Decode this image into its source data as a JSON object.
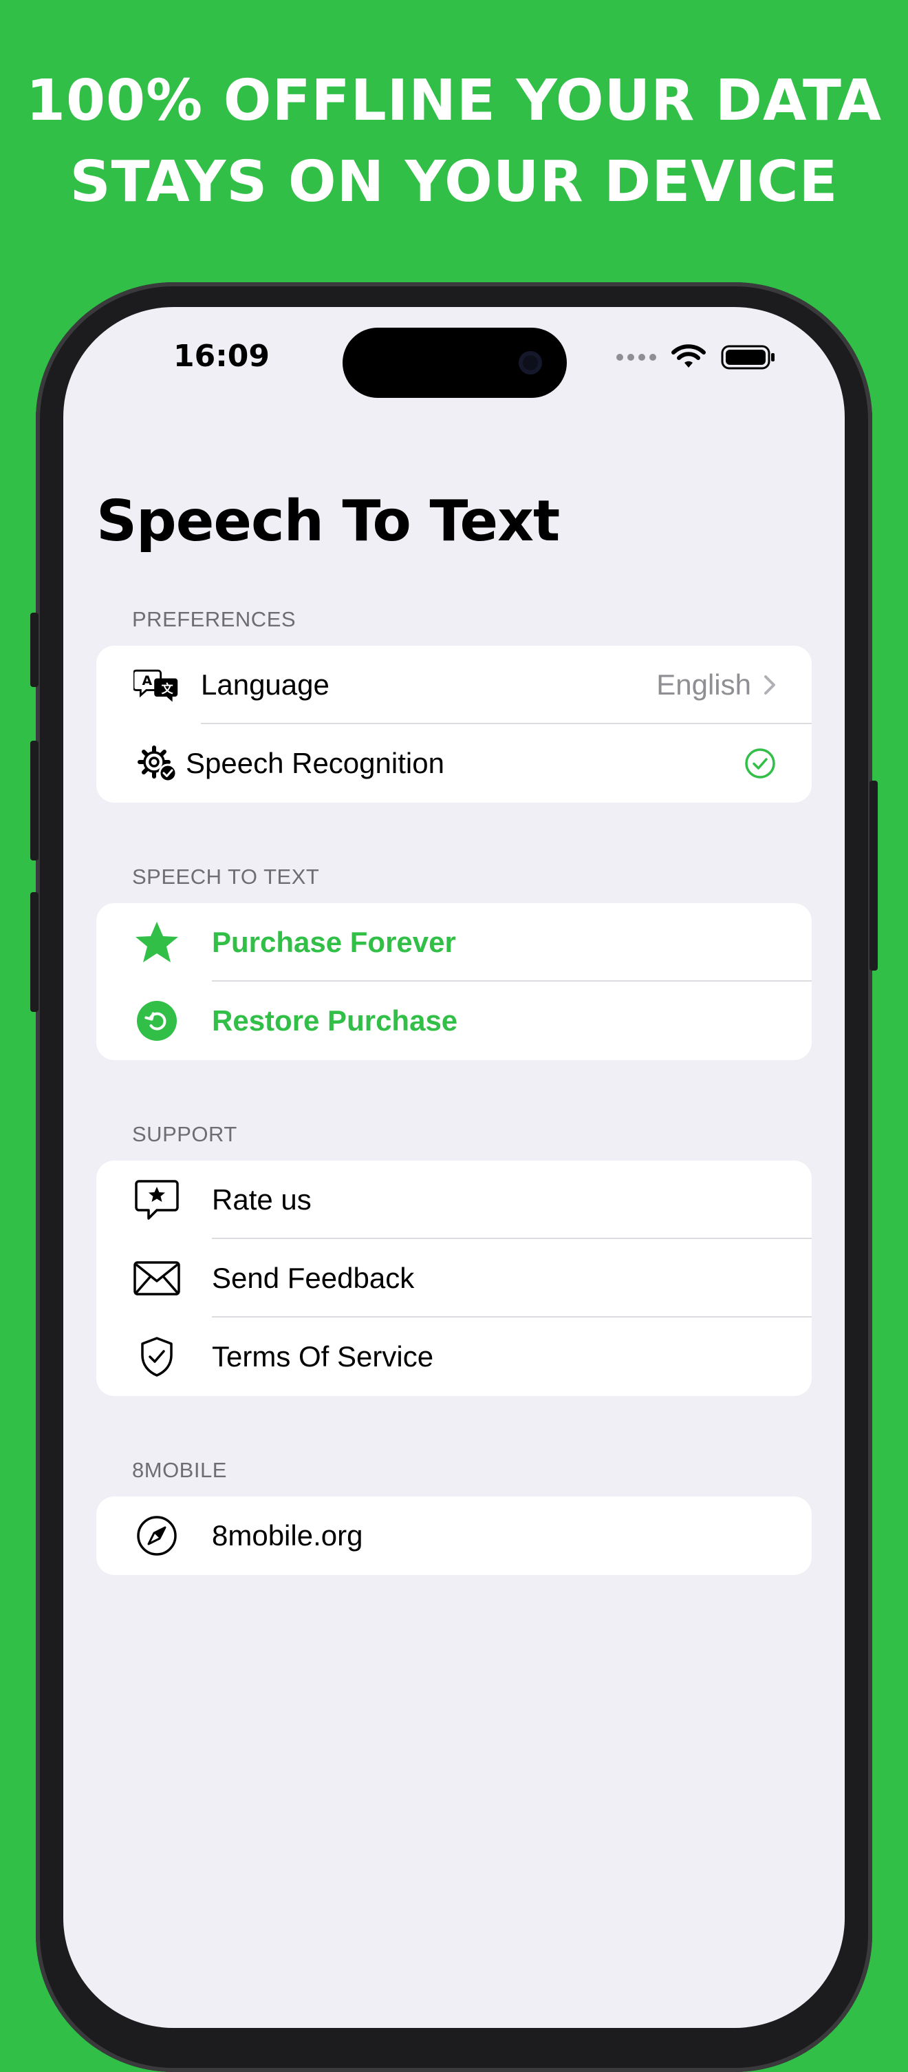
{
  "headline": {
    "line1": "100% OFFLINE YOUR DATA",
    "line2": "STAYS ON YOUR DEVICE"
  },
  "status_bar": {
    "time": "16:09"
  },
  "page_title": "Speech To Text",
  "sections": {
    "preferences": {
      "header": "PREFERENCES",
      "language_label": "Language",
      "language_value": "English",
      "speech_recognition_label": "Speech Recognition"
    },
    "speech_to_text": {
      "header": "SPEECH TO TEXT",
      "purchase_label": "Purchase Forever",
      "restore_label": "Restore Purchase"
    },
    "support": {
      "header": "SUPPORT",
      "rate_label": "Rate us",
      "feedback_label": "Send Feedback",
      "terms_label": "Terms Of Service"
    },
    "eightmobile": {
      "header": "8MOBILE",
      "website_label": "8mobile.org"
    }
  },
  "colors": {
    "brand_green": "#31BF47",
    "screen_background": "#F0EFF5"
  },
  "icons": {
    "language": "translate-icon",
    "speech_recognition": "gear-check-icon",
    "recognition_status": "checkmark-circle-icon",
    "purchase": "star-icon",
    "restore": "restore-icon",
    "rate": "star-bubble-icon",
    "feedback": "envelope-icon",
    "terms": "shield-check-icon",
    "website": "compass-icon"
  }
}
